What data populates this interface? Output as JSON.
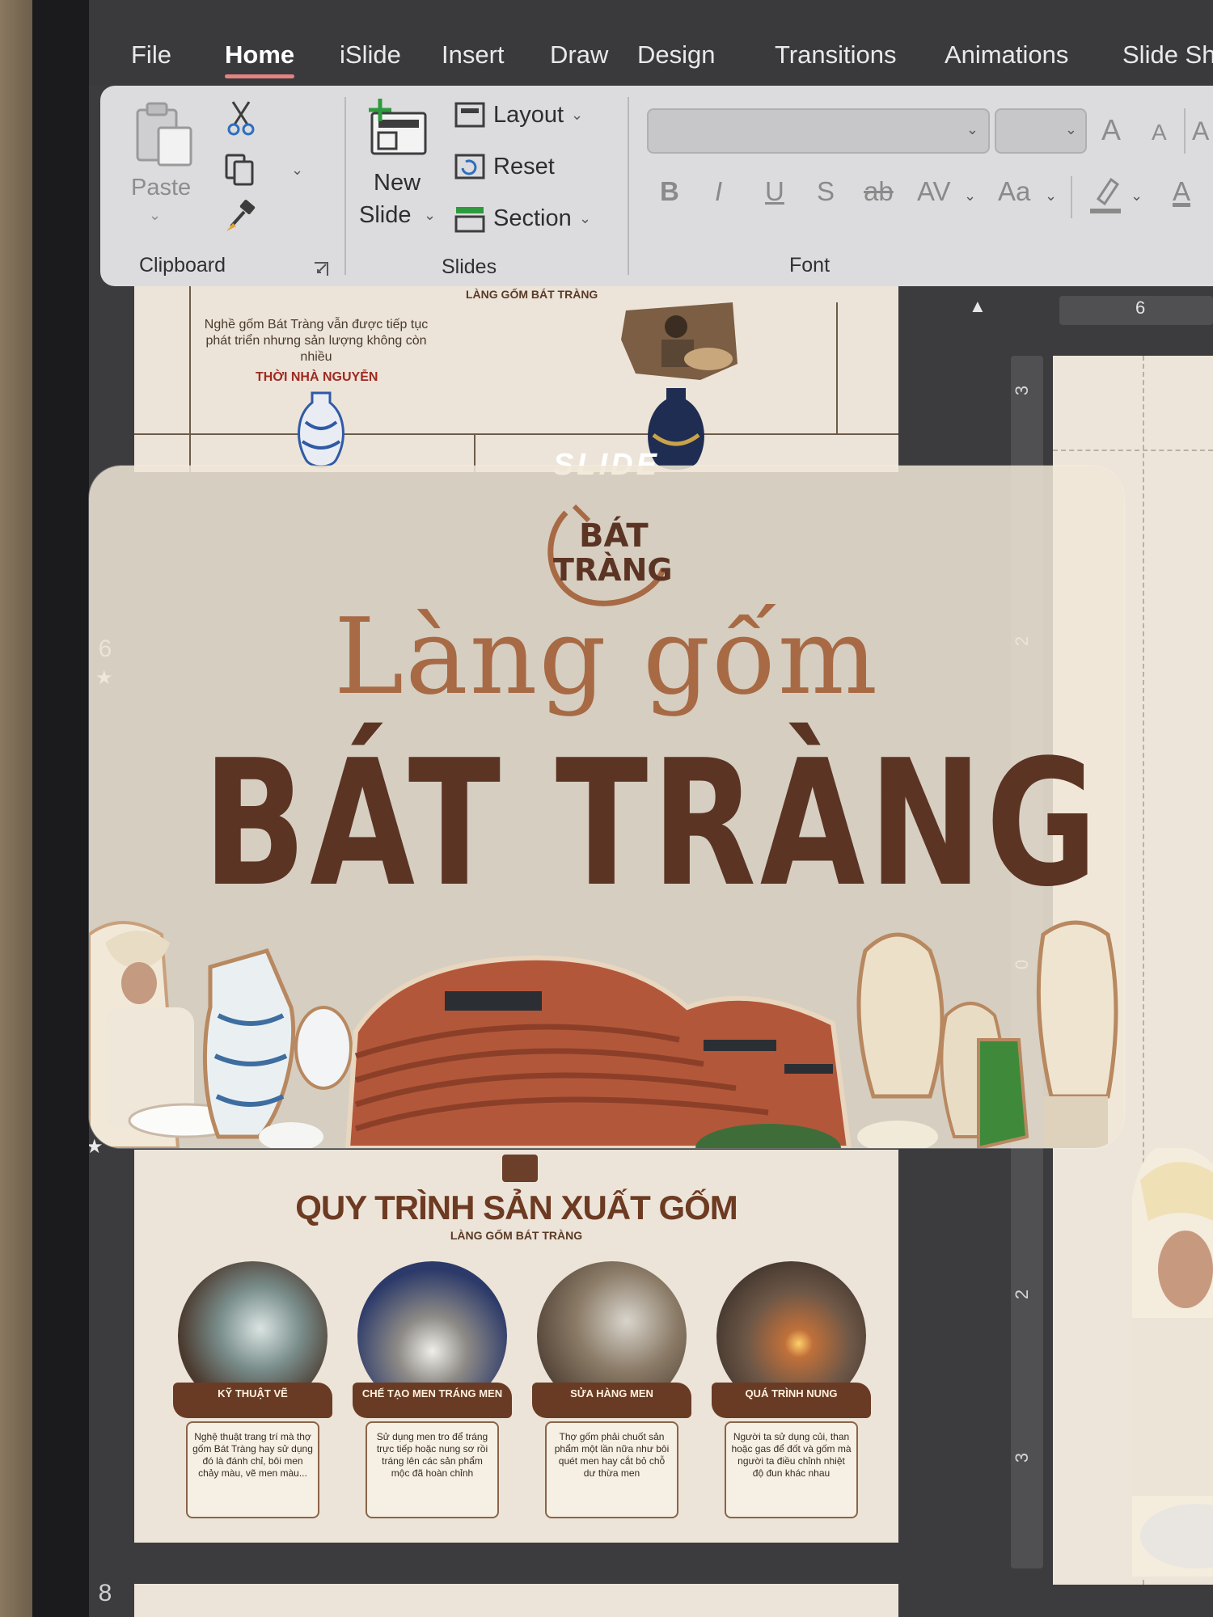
{
  "menu": {
    "items": [
      "File",
      "Home",
      "iSlide",
      "Insert",
      "Draw",
      "Design",
      "Transitions",
      "Animations",
      "Slide Sh"
    ],
    "active": "Home"
  },
  "ribbon": {
    "clipboard": {
      "label": "Clipboard",
      "paste": "Paste"
    },
    "slides": {
      "label": "Slides",
      "new_slide_1": "New",
      "new_slide_2": "Slide",
      "layout": "Layout",
      "reset": "Reset",
      "section": "Section"
    },
    "font": {
      "label": "Font",
      "bold": "B",
      "italic": "I",
      "underline": "U",
      "shadow": "S",
      "strike": "ab",
      "spacing": "AV",
      "case": "Aa",
      "grow": "A",
      "shrink": "A",
      "color": "A"
    }
  },
  "panel": {
    "thumb_numbers": [
      "6",
      "8"
    ],
    "top_slide": {
      "caption": "Nghề gốm Bát Tràng vẫn được tiếp tục phát triển nhưng sản lượng không còn nhiều",
      "period": "THỜI NHÀ NGUYỄN",
      "heading": "LÀNG GỐM BÁT TRÀNG"
    },
    "process_slide": {
      "title": "QUY TRÌNH SẢN XUẤT GỐM",
      "subtitle": "LÀNG GỐM BÁT TRÀNG",
      "steps": [
        {
          "label": "KỸ THUẬT VẼ",
          "text": "Nghệ thuật trang trí mà thợ gốm Bát Tràng hay sử dụng đó là đánh chỉ, bôi men chảy màu, vẽ men màu..."
        },
        {
          "label": "CHẾ TẠO MEN TRÁNG MEN",
          "text": "Sử dụng men tro để tráng trực tiếp hoặc nung sơ rồi tráng lên các sản phẩm mộc đã hoàn chỉnh"
        },
        {
          "label": "SỬA HÀNG MEN",
          "text": "Thợ gốm phải chuốt sản phẩm một lần nữa như bôi quét men hay cắt bỏ chỗ dư thừa men"
        },
        {
          "label": "QUÁ TRÌNH NUNG",
          "text": "Người ta sử dụng củi, than hoặc gas để đốt và gốm mà người ta điều chỉnh nhiệt độ đun khác nhau"
        }
      ]
    }
  },
  "editor": {
    "ruler_top": "6",
    "ruler_side": [
      "3",
      "2",
      "0",
      "2",
      "3"
    ]
  },
  "poster": {
    "tag": "SLIDE",
    "logo_text_1": "BÁT",
    "logo_text_2": "TRÀNG",
    "title_script": "Làng gốm",
    "title_main": "BÁT TRÀNG"
  },
  "colors": {
    "accent_underline": "#e4837f",
    "brown_dark": "#5b3424",
    "brown_light": "#a76a44",
    "ribbon": "#dcdcde"
  }
}
